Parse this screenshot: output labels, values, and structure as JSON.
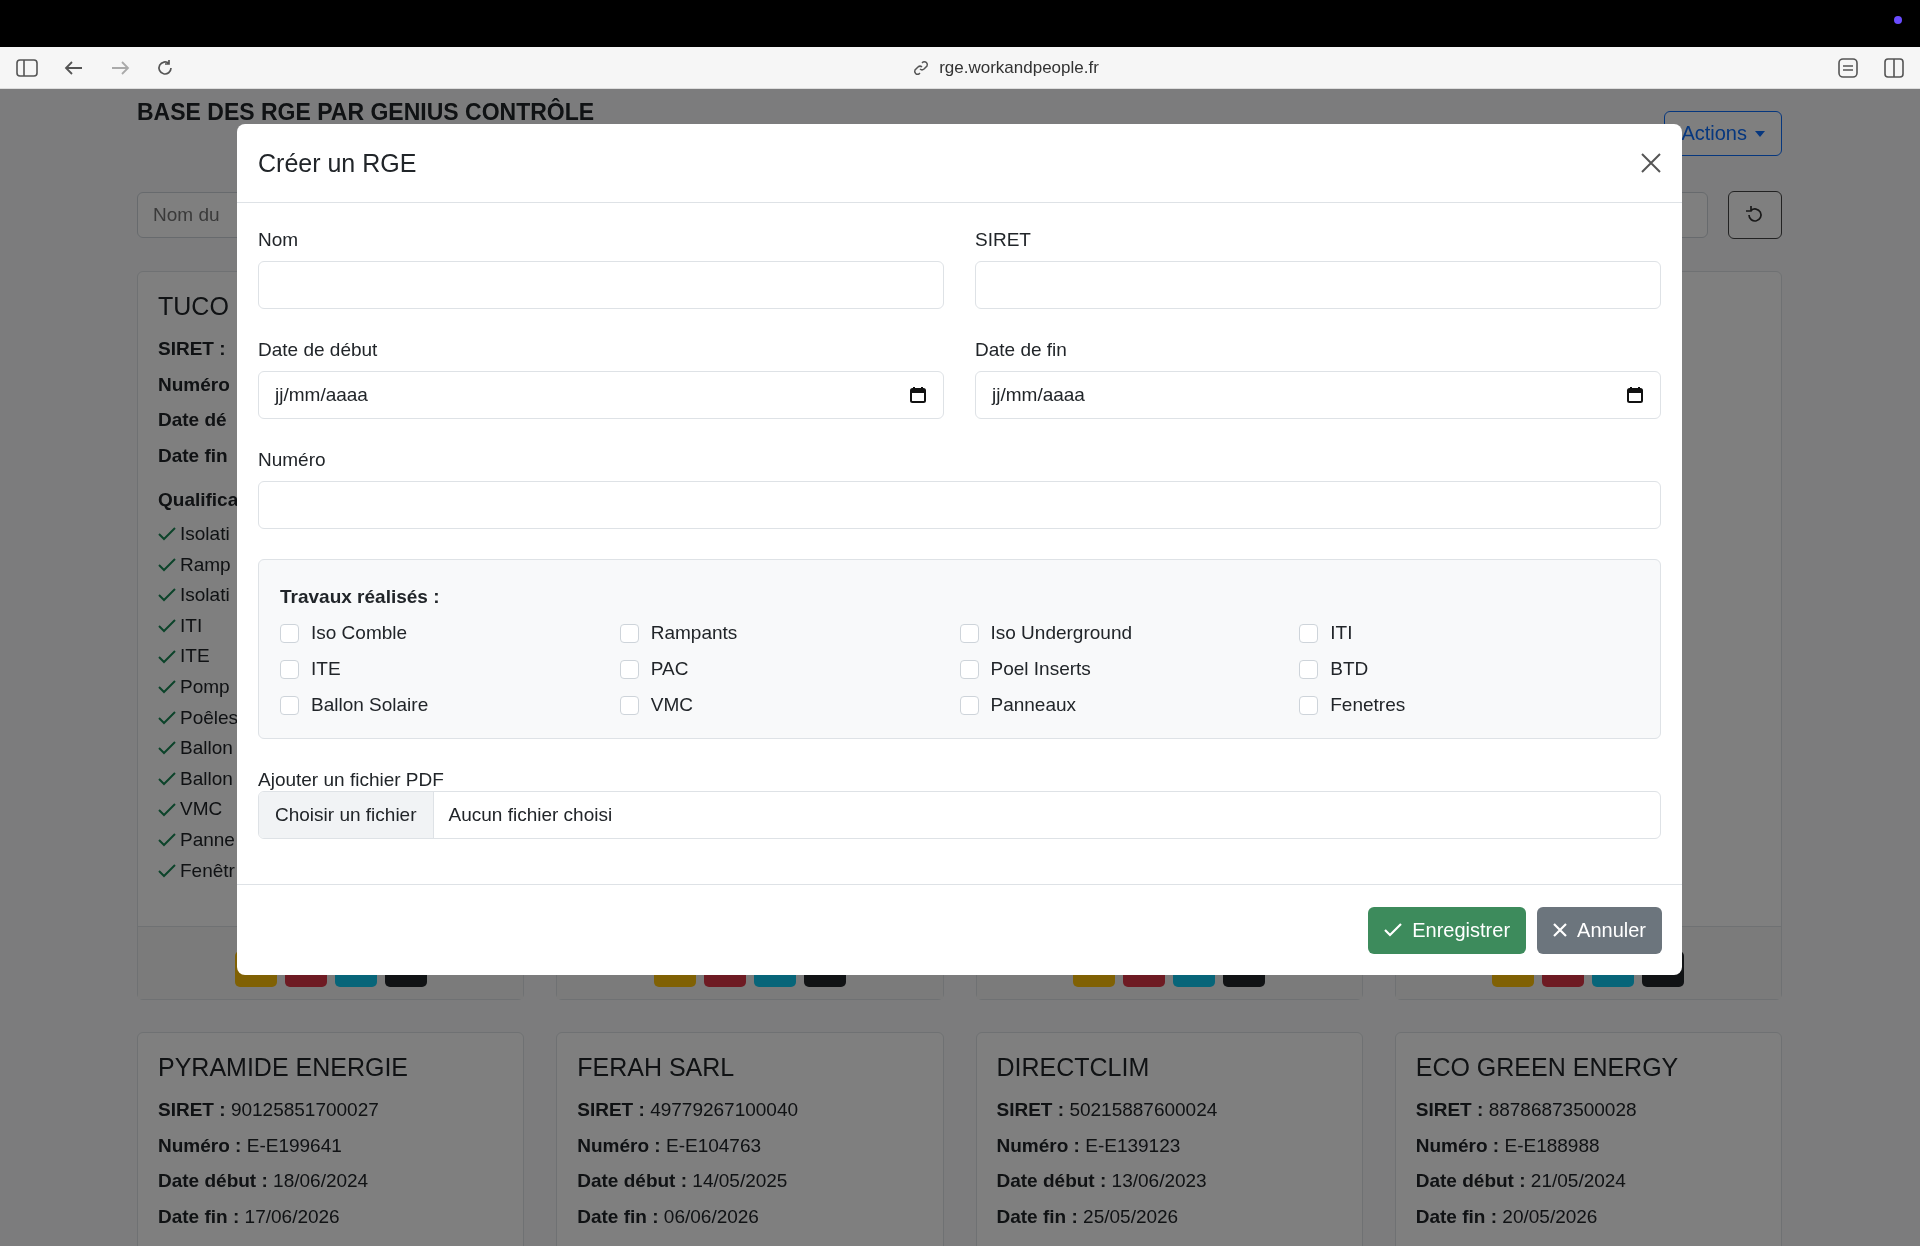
{
  "browser": {
    "url": "rge.workandpeople.fr"
  },
  "page": {
    "title": "BASE DES RGE PAR GENIUS CONTRÔLE",
    "actions_button": "Actions",
    "search": {
      "placeholder": "Nom du"
    },
    "cards": [
      {
        "name": "TUCO",
        "fields": [
          {
            "label": "SIRET :"
          },
          {
            "label": "Numéro"
          },
          {
            "label": "Date dé"
          },
          {
            "label": "Date fin"
          }
        ],
        "qualifications_title": "Qualifica",
        "qualifications": [
          "Isolati",
          "Ramp",
          "Isolati",
          "ITI",
          "ITE",
          "Pomp",
          "Poêles",
          "Ballon",
          "Ballon",
          "VMC",
          "Panne",
          "Fenêtr"
        ],
        "actions": [
          {
            "color": "#806104"
          },
          {
            "color": "#6e1b23"
          },
          {
            "color": "#076579"
          },
          {
            "color": "#111315"
          }
        ]
      },
      {
        "actions": [
          {
            "color": "#806104"
          },
          {
            "color": "#6e1b23"
          },
          {
            "color": "#076579"
          },
          {
            "color": "#111315"
          }
        ]
      },
      {
        "actions": [
          {
            "color": "#806104"
          },
          {
            "color": "#6e1b23"
          },
          {
            "color": "#076579"
          },
          {
            "color": "#111315"
          }
        ]
      },
      {
        "actions": [
          {
            "color": "#806104"
          },
          {
            "color": "#6e1b23"
          },
          {
            "color": "#076579"
          },
          {
            "color": "#111315"
          }
        ]
      },
      {
        "name": "PYRAMIDE ENERGIE",
        "fields": [
          {
            "label": "SIRET :",
            "value": "90125851700027"
          },
          {
            "label": "Numéro :",
            "value": "E-E199641"
          },
          {
            "label": "Date début :",
            "value": "18/06/2024"
          },
          {
            "label": "Date fin :",
            "value": "17/06/2026"
          }
        ]
      },
      {
        "name": "FERAH SARL",
        "fields": [
          {
            "label": "SIRET :",
            "value": "49779267100040"
          },
          {
            "label": "Numéro :",
            "value": "E-E104763"
          },
          {
            "label": "Date début :",
            "value": "14/05/2025"
          },
          {
            "label": "Date fin :",
            "value": "06/06/2026"
          }
        ]
      },
      {
        "name": "DIRECTCLIM",
        "fields": [
          {
            "label": "SIRET :",
            "value": "50215887600024"
          },
          {
            "label": "Numéro :",
            "value": "E-E139123"
          },
          {
            "label": "Date début :",
            "value": "13/06/2023"
          },
          {
            "label": "Date fin :",
            "value": "25/05/2026"
          }
        ]
      },
      {
        "name": "ECO GREEN ENERGY",
        "fields": [
          {
            "label": "SIRET :",
            "value": "88786873500028"
          },
          {
            "label": "Numéro :",
            "value": "E-E188988"
          },
          {
            "label": "Date début :",
            "value": "21/05/2024"
          },
          {
            "label": "Date fin :",
            "value": "20/05/2026"
          }
        ]
      }
    ]
  },
  "modal": {
    "title": "Créer un RGE",
    "field_rows": [
      [
        {
          "kind": "text",
          "label": "Nom"
        },
        {
          "kind": "text",
          "label": "SIRET"
        }
      ],
      [
        {
          "kind": "date",
          "label": "Date de début",
          "value": "jj/mm/aaaa"
        },
        {
          "kind": "date",
          "label": "Date de fin",
          "value": "jj/mm/aaaa"
        }
      ],
      [
        {
          "kind": "text",
          "label": "Numéro"
        }
      ]
    ],
    "works": {
      "title": "Travaux réalisés :",
      "items": [
        {
          "label": "Iso Comble",
          "checked": false
        },
        {
          "label": "Rampants",
          "checked": false
        },
        {
          "label": "Iso Underground",
          "checked": false
        },
        {
          "label": "ITI",
          "checked": false
        },
        {
          "label": "ITE",
          "checked": false
        },
        {
          "label": "PAC",
          "checked": false
        },
        {
          "label": "Poel Inserts",
          "checked": false
        },
        {
          "label": "BTD",
          "checked": false
        },
        {
          "label": "Ballon Solaire",
          "checked": false
        },
        {
          "label": "VMC",
          "checked": false
        },
        {
          "label": "Panneaux",
          "checked": false
        },
        {
          "label": "Fenetres",
          "checked": false
        }
      ]
    },
    "file": {
      "label": "Ajouter un fichier PDF",
      "button": "Choisir un fichier",
      "status": "Aucun fichier choisi"
    },
    "save_button": "Enregistrer",
    "cancel_button": "Annuler"
  }
}
